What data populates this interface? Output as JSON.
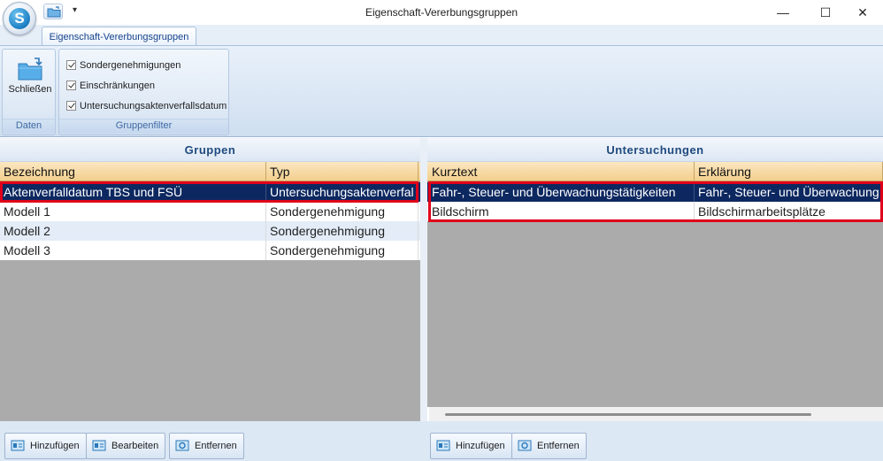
{
  "window": {
    "title": "Eigenschaft-Vererbungsgruppen",
    "minimize": "—",
    "maximize": "☐",
    "close": "✕",
    "qat_dropdown": "▾",
    "logo_letter": "S"
  },
  "ribbon": {
    "tab_label": "Eigenschaft-Vererbungsgruppen",
    "groups": {
      "daten": {
        "label": "Daten",
        "close_button": {
          "label": "Schließen",
          "icon": "folder-back-icon"
        }
      },
      "gruppenfilter": {
        "label": "Gruppenfilter",
        "checkboxes": [
          {
            "label": "Sondergenehmigungen",
            "checked": true
          },
          {
            "label": "Einschränkungen",
            "checked": true
          },
          {
            "label": "Untersuchungsaktenverfallsdatum",
            "checked": true
          }
        ]
      }
    }
  },
  "gruppen": {
    "title": "Gruppen",
    "columns": [
      "Bezeichnung",
      "Typ"
    ],
    "rows": [
      {
        "bezeichnung": "Aktenverfalldatum TBS und FSÜ",
        "typ": "Untersuchungsaktenverfal",
        "selected": true
      },
      {
        "bezeichnung": "Modell 1",
        "typ": "Sondergenehmigung",
        "selected": false
      },
      {
        "bezeichnung": "Modell 2",
        "typ": "Sondergenehmigung",
        "selected": false
      },
      {
        "bezeichnung": "Modell 3",
        "typ": "Sondergenehmigung",
        "selected": false
      }
    ],
    "buttons": [
      "Hinzufügen",
      "Bearbeiten",
      "Entfernen"
    ]
  },
  "untersuchungen": {
    "title": "Untersuchungen",
    "columns": [
      "Kurztext",
      "Erklärung"
    ],
    "rows": [
      {
        "kurztext": "Fahr-, Steuer- und Überwachungstätigkeiten",
        "erklaerung": "Fahr-, Steuer- und Überwachung",
        "selected": true
      },
      {
        "kurztext": "Bildschirm",
        "erklaerung": "Bildschirmarbeitsplätze",
        "selected": false
      }
    ],
    "buttons": [
      "Hinzufügen",
      "Entfernen"
    ]
  },
  "colors": {
    "selection": "#0d2860",
    "highlight_border": "#e0001b",
    "header_gold": "#f3cf8d"
  }
}
